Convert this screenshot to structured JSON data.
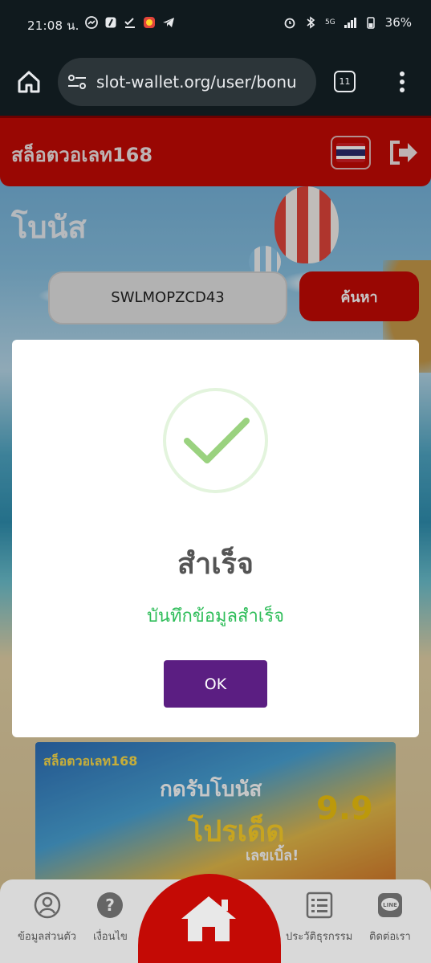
{
  "status_bar": {
    "time": "21:08 น.",
    "network": "5G",
    "battery": "36%"
  },
  "browser": {
    "url": "slot-wallet.org/user/bonu",
    "tab_count": "11"
  },
  "site": {
    "logo": "สล็อตวอเลท168",
    "page_title": "โบนัส",
    "code_value": "SWLMOPZCD43",
    "search_label": "ค้นหา"
  },
  "banner": {
    "brand": "สล็อตวอเลท168",
    "line1": "กดรับโบนัส",
    "line2": "โปรเด็ด",
    "big": "9.9",
    "line3": "เลขเบิ้ล!"
  },
  "modal": {
    "title": "สำเร็จ",
    "message": "บันทึกข้อมูลสำเร็จ",
    "ok_label": "OK"
  },
  "bottom_nav": {
    "profile": "ข้อมูลส่วนตัว",
    "terms": "เงื่อนไข",
    "history": "ประวัติธุรกรรม",
    "contact": "ติดต่อเรา"
  },
  "colors": {
    "brand_red": "#c40a05",
    "ok_purple": "#5b1e82",
    "success_green": "#2ebd59"
  }
}
